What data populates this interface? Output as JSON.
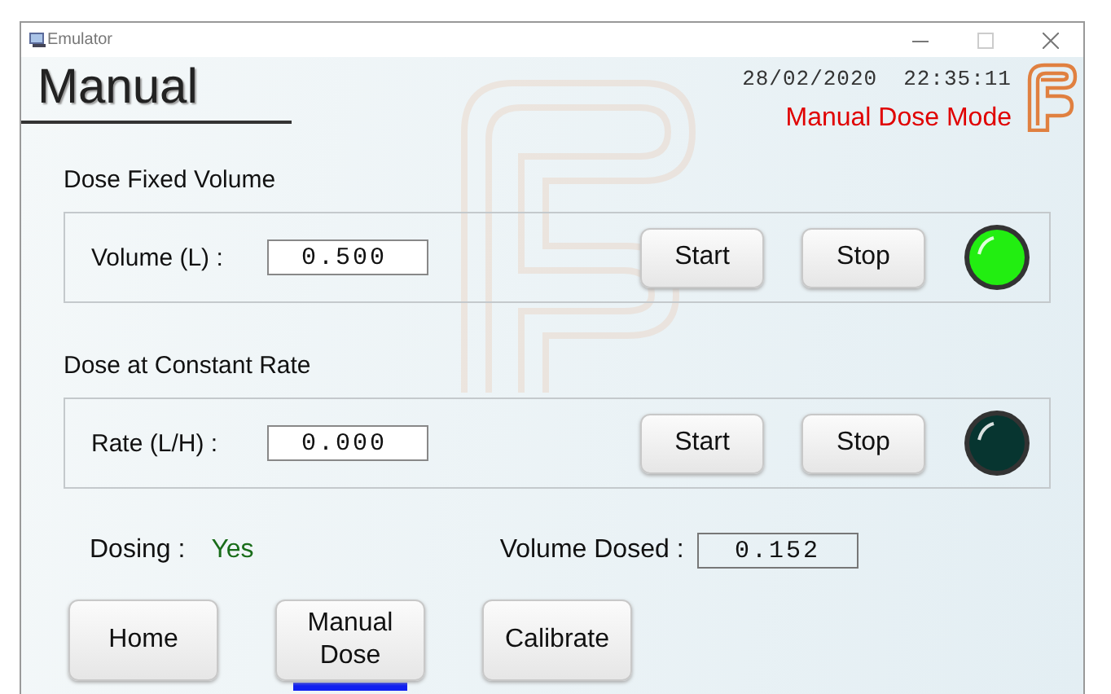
{
  "window": {
    "title": "Emulator"
  },
  "header": {
    "title": "Manual",
    "date": "28/02/2020",
    "time": "22:35:11",
    "mode": "Manual Dose Mode"
  },
  "groups": [
    {
      "title": "Dose Fixed Volume",
      "label": "Volume (L) :",
      "value": "0.500",
      "buttons": [
        "Start",
        "Stop"
      ],
      "indicator_on": true
    },
    {
      "title": "Dose at Constant Rate",
      "label": "Rate (L/H) :",
      "value": "0.000",
      "buttons": [
        "Start",
        "Stop"
      ],
      "indicator_on": false
    }
  ],
  "status": {
    "dosing_label": "Dosing :",
    "dosing_value": "Yes",
    "volume_label": "Volume Dosed :",
    "volume_value": "0.152"
  },
  "nav": [
    {
      "label": "Home",
      "selected": false
    },
    {
      "label": "Manual\nDose",
      "selected": true
    },
    {
      "label": "Calibrate",
      "selected": false
    }
  ]
}
